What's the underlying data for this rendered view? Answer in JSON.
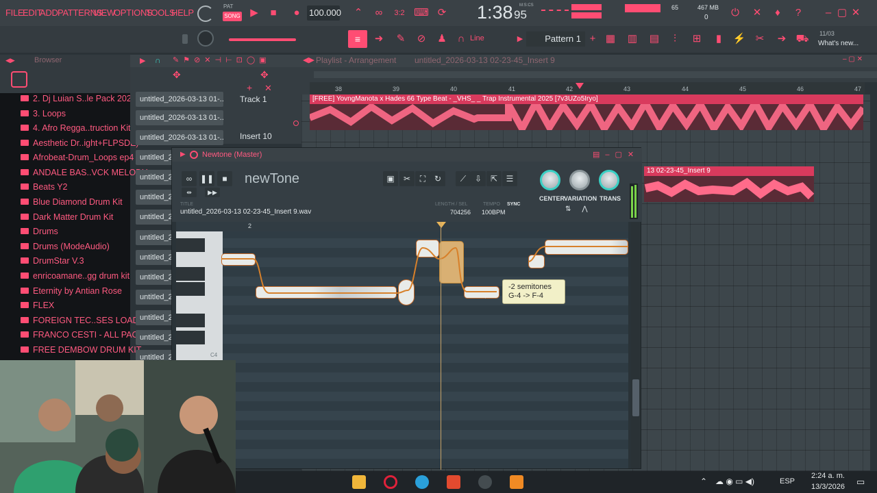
{
  "menu": [
    "FILE",
    "EDIT",
    "ADD",
    "PATTERNS",
    "VIEW",
    "OPTIONS",
    "TOOLS",
    "HELP"
  ],
  "transport": {
    "pat_label": "PAT",
    "song_label": "SONG",
    "tempo": "100.000",
    "time": "1:38",
    "time_small": "95",
    "time_unit": "M:S:CS",
    "cpu_value": "65",
    "memory": "467 MB",
    "voices": "0"
  },
  "toolbar2": {
    "snap": "Line",
    "pattern": "Pattern 1",
    "news_date": "11/03",
    "news_text": "What's new..."
  },
  "browser": {
    "title": "Browser",
    "items": [
      "2. Dj Luian S..le Pack 2020",
      "3. Loops",
      "4. Afro Regga..truction Kits",
      "Aesthetic Dr..ight+FLPSDE)",
      "Afrobeat-Drum_Loops ep4",
      "ANDALE BAS..VCK MELODY",
      "Beats Y2",
      "Blue Diamond Drum Kit",
      "Dark Matter Drum Kit",
      "Drums",
      "Drums (ModeAudio)",
      "DrumStar V.3",
      "enricoamane..gg drum kit",
      "Eternity by Antian Rose",
      "FLEX",
      "FOREIGN TEC..SES LOADED",
      "FRANCO CESTI - ALL PACKS",
      "FREE DEMBOW DRUM KIT"
    ]
  },
  "channels": [
    "untitled_2026-03-13 01-...",
    "untitled_2026-03-13 01-...",
    "untitled_2026-03-13 01-...",
    "untitled_2",
    "untitled_2",
    "untitled_2",
    "untitled_2",
    "untitled_2",
    "untitled_2",
    "untitled_2",
    "untitled_2",
    "untitled_2",
    "untitled_2",
    "untitled_2"
  ],
  "playlist": {
    "title": "Playlist - Arrangement",
    "file": "untitled_2026-03-13 02-23-45_Insert 9",
    "track1": "Track 1",
    "insert_label": "Insert 10",
    "ruler": [
      "38",
      "39",
      "40",
      "41",
      "42",
      "43",
      "44",
      "45",
      "46",
      "47"
    ],
    "clip1": "[FREE] YovngManota x Hades 66 Type Beat - _VHS_ _ Trap Instrumental 2025 [7v3UZo5Iryo]",
    "clip2": "13 02-23-45_Insert 9"
  },
  "newtone": {
    "window_title": "Newtone (Master)",
    "logo": "newTone",
    "title_label": "TITLE",
    "title_value": "untitled_2026-03-13 02-23-45_Insert 9.wav",
    "length_label": "LENGTH / SEL",
    "length_value": "704256",
    "tempo_label": "TEMPO",
    "sync_label": "SYNC",
    "tempo_value": "100BPM",
    "knobs": [
      "CENTER",
      "VARIATION",
      "TRANS"
    ],
    "bar_marker": "2",
    "c4_label": "C4",
    "tooltip_line1": "-2 semitones",
    "tooltip_line2": "G-4 -> F-4"
  },
  "taskbar": {
    "lang": "ESP",
    "time": "2:24 a. m.",
    "date": "13/3/2026"
  },
  "colors": {
    "accent": "#ff4d73",
    "teal": "#3ad1c5",
    "note_border": "#c46a2a"
  }
}
